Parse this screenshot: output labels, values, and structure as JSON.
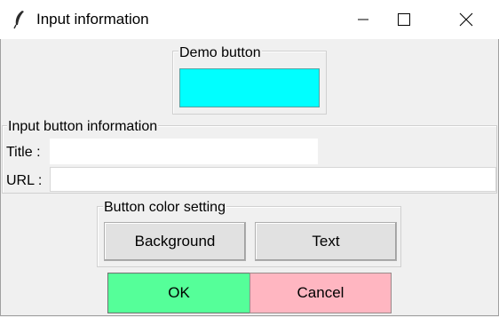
{
  "window": {
    "title": "Input information",
    "icon": "feather-icon",
    "controls": [
      "minimize-icon",
      "maximize-icon",
      "close-icon"
    ]
  },
  "demo": {
    "legend": "Demo button",
    "button_color": "#00ffff",
    "button_label": ""
  },
  "info": {
    "legend": "Input button information",
    "title_label": "Title :",
    "title_value": "",
    "url_label": "URL :",
    "url_value": ""
  },
  "color_setting": {
    "legend": "Button color setting",
    "background_label": "Background",
    "text_label": "Text"
  },
  "actions": {
    "ok_label": "OK",
    "ok_color": "#55ff99",
    "cancel_label": "Cancel",
    "cancel_color": "#ffb6c1"
  }
}
